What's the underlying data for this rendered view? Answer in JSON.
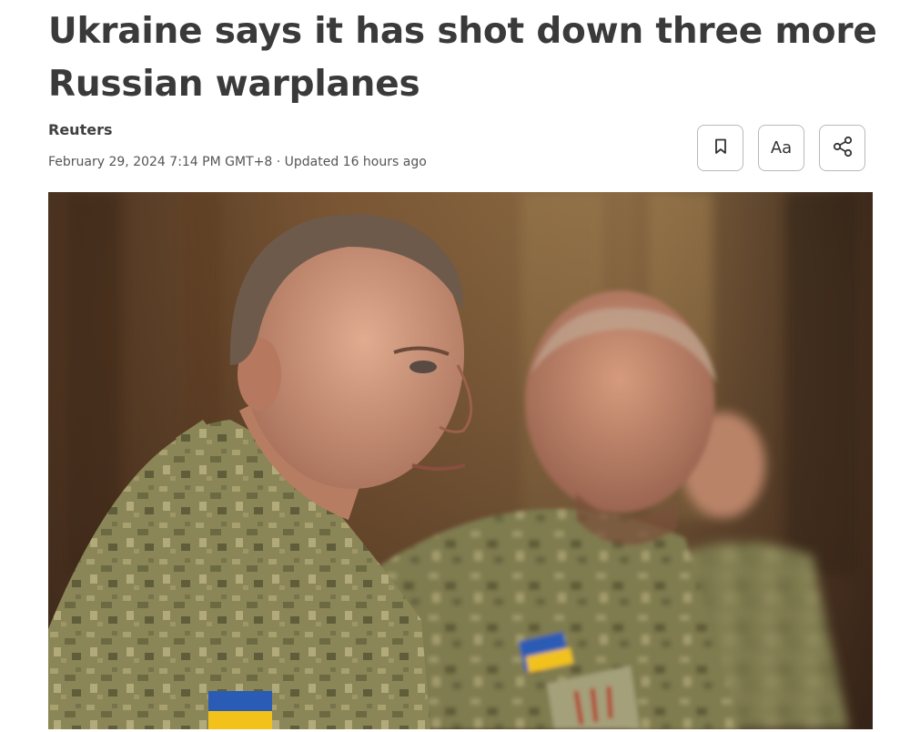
{
  "article": {
    "headline": "Ukraine says it has shot down three more Russian warplanes",
    "source": "Reuters",
    "date": "February 29, 2024 7:14 PM GMT+8",
    "separator": "·",
    "updated": "Updated 16 hours ago"
  },
  "toolbar": {
    "bookmark_icon": "bookmark-icon",
    "text_size_label": "Aa",
    "share_icon": "share-icon"
  },
  "hero_image": {
    "subject": "two-officers-in-camouflage-uniforms",
    "colors": {
      "background": "#6b4a2c",
      "camo": "#8a8558",
      "skin": "#c98f72",
      "flag_blue": "#2a5bb5",
      "flag_yellow": "#f2c21a"
    }
  }
}
